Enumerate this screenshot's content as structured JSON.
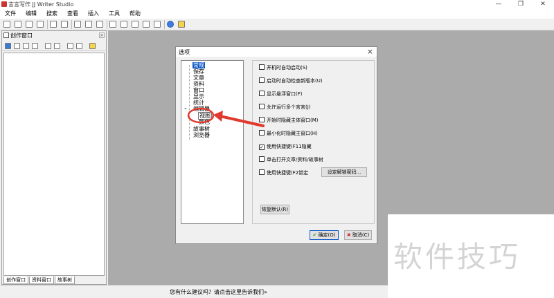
{
  "window": {
    "title": "言言写作 JJ Writer Studio",
    "controls": [
      "—",
      "❐",
      "✕"
    ]
  },
  "menu": [
    "文件",
    "编辑",
    "搜索",
    "查看",
    "插入",
    "工具",
    "帮助"
  ],
  "left_panel": {
    "title": "创作窗口",
    "tabs": [
      "创作窗口",
      "资料窗口",
      "故事树"
    ]
  },
  "status": {
    "message": "您有什么建议吗？请点击这里告诉我们»"
  },
  "dialog": {
    "title": "选项",
    "close": "×",
    "tree": {
      "items": [
        "常规",
        "保存",
        "文章",
        "资料",
        "窗口",
        "显示",
        "统计",
        "编辑器",
        "视图",
        "颜色",
        "故事树",
        "浏览器"
      ],
      "expander": "⌄",
      "selected": "常规",
      "highlighted": "视图"
    },
    "options": [
      {
        "label": "开机时自动启动(S)",
        "checked": false
      },
      {
        "label": "启动时自动检查新版本(U)",
        "checked": false
      },
      {
        "label": "显示悬浮窗口(F)",
        "checked": false
      },
      {
        "label": "允许运行多个言言(J)",
        "checked": false
      },
      {
        "label": "开始时隐藏主体窗口(M)",
        "checked": false
      },
      {
        "label": "最小化时隐藏主窗口(H)",
        "checked": false
      },
      {
        "label": "使用快捷键(F11隐藏",
        "checked": true
      },
      {
        "label": "单击打开文章/资料/故事树",
        "checked": false
      },
      {
        "label": "使用快捷键(F2锁定",
        "checked": false
      }
    ],
    "check_mark": "✓",
    "set_password_button": "设定解锁密码...",
    "restore_default_button": "恢复默认(R)",
    "ok_button": "确定(O)",
    "cancel_button": "取消(C)",
    "ok_icon": "✔",
    "cancel_icon": "✖"
  },
  "colors": {
    "annotation_red": "#e03a2e",
    "selection_blue": "#0a56c8",
    "workspace_gray": "#ababab"
  },
  "watermark": "软件技巧"
}
